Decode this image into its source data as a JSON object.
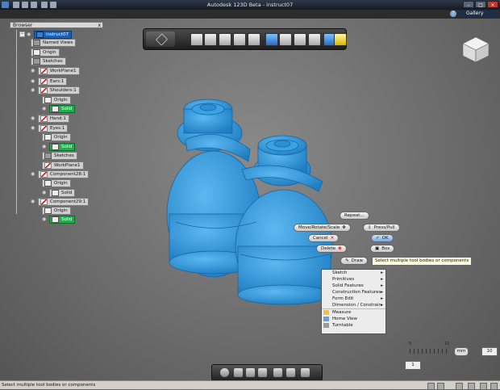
{
  "window": {
    "title": "Autodesk 123D Beta - instruct07",
    "gallery_label": "Gallery",
    "help_glyph": "?",
    "min_glyph": "–",
    "max_glyph": "□",
    "close_glyph": "×"
  },
  "browser": {
    "header": "Browser",
    "close_glyph": "x",
    "nodes": [
      {
        "label": "instruct07",
        "icon": "document-icon",
        "style": "sel"
      },
      {
        "label": "Named Views",
        "icon": "folder-icon",
        "style": ""
      },
      {
        "label": "Origin",
        "icon": "origin-icon",
        "style": ""
      },
      {
        "label": "Sketches",
        "icon": "folder-icon",
        "style": ""
      },
      {
        "label": "WorkPlane1",
        "icon": "workplane-icon",
        "style": ""
      },
      {
        "label": "Ears:1",
        "icon": "component-icon",
        "style": ""
      },
      {
        "label": "Shoulders:1",
        "icon": "component-icon",
        "style": ""
      },
      {
        "label": "Origin",
        "icon": "origin-icon",
        "style": ""
      },
      {
        "label": "Solid",
        "icon": "solid-icon",
        "style": "solid"
      },
      {
        "label": "Hand:1",
        "icon": "component-icon",
        "style": ""
      },
      {
        "label": "Eyes:1",
        "icon": "component-icon",
        "style": ""
      },
      {
        "label": "Origin",
        "icon": "origin-icon",
        "style": ""
      },
      {
        "label": "Solid",
        "icon": "solid-icon",
        "style": "solid"
      },
      {
        "label": "Sketches",
        "icon": "folder-icon",
        "style": ""
      },
      {
        "label": "WorkPlane1",
        "icon": "workplane-icon",
        "style": ""
      },
      {
        "label": "Component28:1",
        "icon": "component-icon",
        "style": ""
      },
      {
        "label": "Origin",
        "icon": "origin-icon",
        "style": ""
      },
      {
        "label": "Solid",
        "icon": "solid-icon",
        "style": ""
      },
      {
        "label": "Component29:1",
        "icon": "component-icon",
        "style": ""
      },
      {
        "label": "Origin",
        "icon": "origin-icon",
        "style": ""
      },
      {
        "label": "Solid",
        "icon": "solid-icon",
        "style": "solid"
      }
    ]
  },
  "toolbar": {
    "buttons": [
      "transform-icon",
      "primitive-box-icon",
      "sketch-icon",
      "construct-icon",
      "modify-icon",
      "pattern-icon",
      "grouping-icon",
      "combine-icon",
      "measure-icon",
      "text-3d-icon",
      "material-icon"
    ]
  },
  "marking_menu": {
    "repeat": "Repeat...",
    "move": "Move/Rotate/Scale",
    "presspull": "Press/Pull",
    "cancel": "Cancel",
    "ok": "OK",
    "delete": "Delete",
    "box": "Box",
    "draw": "Draw"
  },
  "tooltip": "Select multiple tool bodies or components",
  "context_menu": {
    "items": [
      {
        "label": "Sketch",
        "submenu": true
      },
      {
        "label": "Primitives",
        "submenu": true
      },
      {
        "label": "Solid Features",
        "submenu": true
      },
      {
        "label": "Construction Features",
        "submenu": true
      },
      {
        "label": "Form Edit",
        "submenu": true
      },
      {
        "label": "Dimension / Constrain",
        "submenu": true
      },
      {
        "label": "Measure",
        "submenu": false
      },
      {
        "label": "Home View",
        "submenu": false
      },
      {
        "label": "Turntable",
        "submenu": false
      }
    ]
  },
  "grid": {
    "ruler_min": "0",
    "ruler_max": "10",
    "units": "mm",
    "value": "10",
    "step": "1"
  },
  "status": {
    "text": "Select multiple tool bodies or components"
  },
  "colors": {
    "model": "#2e95d8",
    "selection": "#1d5fb0",
    "solid_node": "#19b34a"
  }
}
